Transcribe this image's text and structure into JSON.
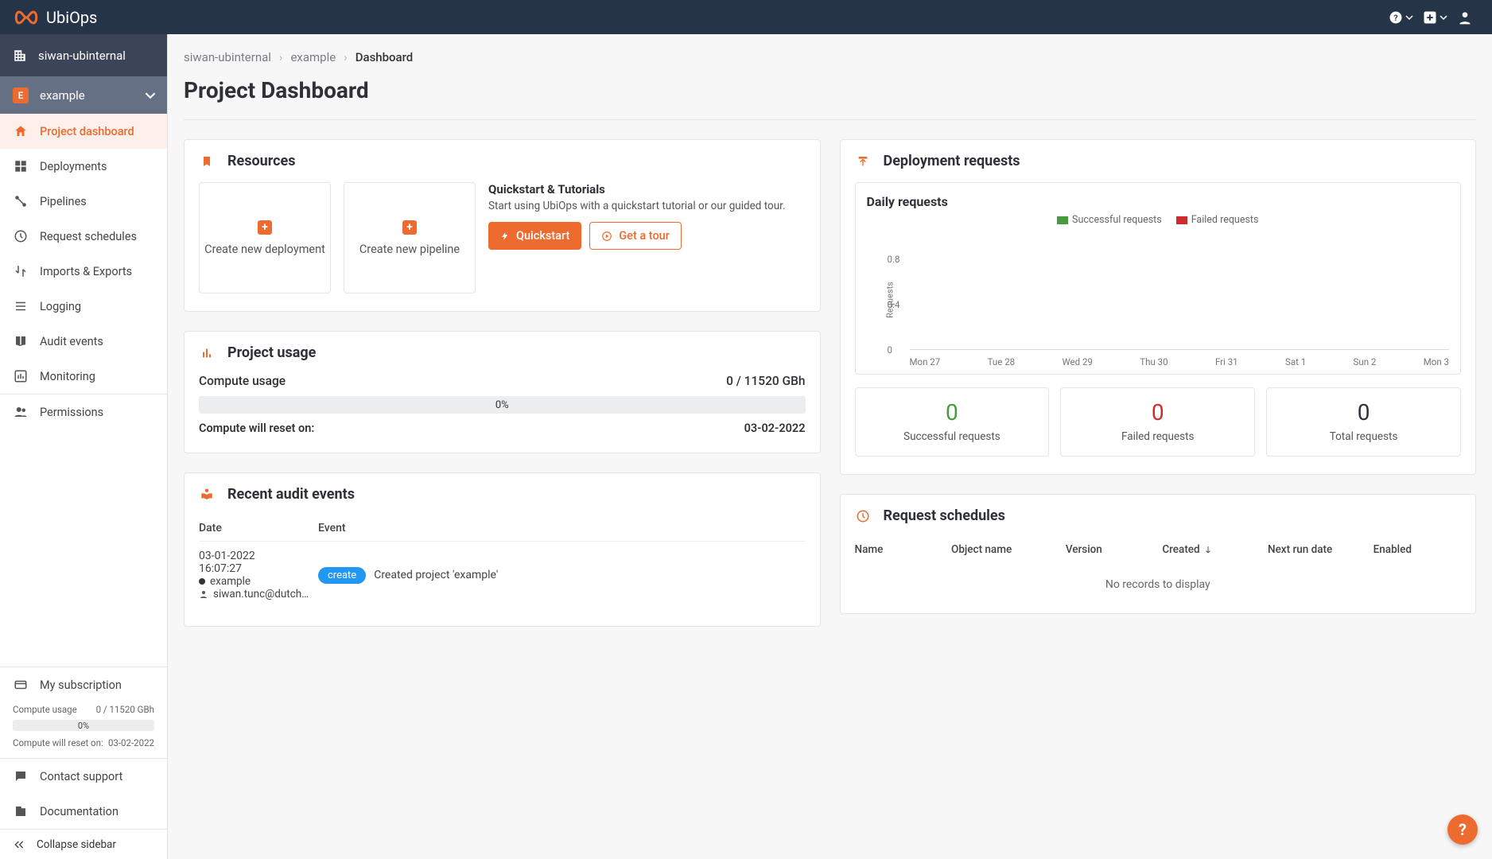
{
  "brand": "UbiOps",
  "topbar": {
    "help_label": "Help",
    "add_label": "New",
    "user_label": "Account"
  },
  "org": {
    "name": "siwan-ubinternal"
  },
  "project": {
    "badge": "E",
    "name": "example"
  },
  "sidebar": {
    "items": [
      {
        "label": "Project dashboard"
      },
      {
        "label": "Deployments"
      },
      {
        "label": "Pipelines"
      },
      {
        "label": "Request schedules"
      },
      {
        "label": "Imports & Exports"
      },
      {
        "label": "Logging"
      },
      {
        "label": "Audit events"
      },
      {
        "label": "Monitoring"
      },
      {
        "label": "Permissions"
      }
    ],
    "subscription_label": "My subscription",
    "compute_usage_label": "Compute usage",
    "compute_usage_value": "0 / 11520 GBh",
    "bar_pct": "0%",
    "reset_label": "Compute will reset on:",
    "reset_value": "03-02-2022",
    "contact_label": "Contact support",
    "docs_label": "Documentation",
    "collapse_label": "Collapse sidebar"
  },
  "breadcrumb": {
    "a": "siwan-ubinternal",
    "b": "example",
    "c": "Dashboard"
  },
  "page_title": "Project Dashboard",
  "resources": {
    "title": "Resources",
    "create_deployment": "Create new deployment",
    "create_pipeline": "Create new pipeline",
    "qs_title": "Quickstart & Tutorials",
    "qs_body": "Start using UbiOps with a quickstart tutorial or our guided tour.",
    "quickstart_btn": "Quickstart",
    "tour_btn": "Get a tour"
  },
  "usage": {
    "title": "Project usage",
    "compute_label": "Compute usage",
    "compute_value": "0 / 11520 GBh",
    "bar_pct": "0%",
    "reset_label": "Compute will reset on:",
    "reset_value": "03-02-2022"
  },
  "requests": {
    "title": "Deployment requests",
    "chart_title": "Daily requests",
    "legend_success": "Successful requests",
    "legend_failed": "Failed requests",
    "ylabel": "Requests",
    "stats": {
      "success_n": "0",
      "success_l": "Successful requests",
      "failed_n": "0",
      "failed_l": "Failed requests",
      "total_n": "0",
      "total_l": "Total requests"
    }
  },
  "audit": {
    "title": "Recent audit events",
    "col_date": "Date",
    "col_event": "Event",
    "row0": {
      "date": "03-01-2022 16:07:27",
      "project": "example",
      "user": "siwan.tunc@dutch…",
      "action": "create",
      "text": "Created project 'example'"
    }
  },
  "schedules": {
    "title": "Request schedules",
    "cols": {
      "name": "Name",
      "object": "Object name",
      "version": "Version",
      "created": "Created",
      "next": "Next run date",
      "enabled": "Enabled"
    },
    "empty": "No records to display"
  },
  "chart_data": {
    "type": "bar",
    "title": "Daily requests",
    "xlabel": "",
    "ylabel": "Requests",
    "ylim": [
      0,
      1
    ],
    "yticks": [
      0,
      0.4,
      0.8
    ],
    "categories": [
      "Mon 27",
      "Tue 28",
      "Wed 29",
      "Thu 30",
      "Fri 31",
      "Sat 1",
      "Sun 2",
      "Mon 3"
    ],
    "series": [
      {
        "name": "Successful requests",
        "color": "#479b3e",
        "values": [
          0,
          0,
          0,
          0,
          0,
          0,
          0,
          0
        ]
      },
      {
        "name": "Failed requests",
        "color": "#cf2b2b",
        "values": [
          0,
          0,
          0,
          0,
          0,
          0,
          0,
          0
        ]
      }
    ]
  }
}
